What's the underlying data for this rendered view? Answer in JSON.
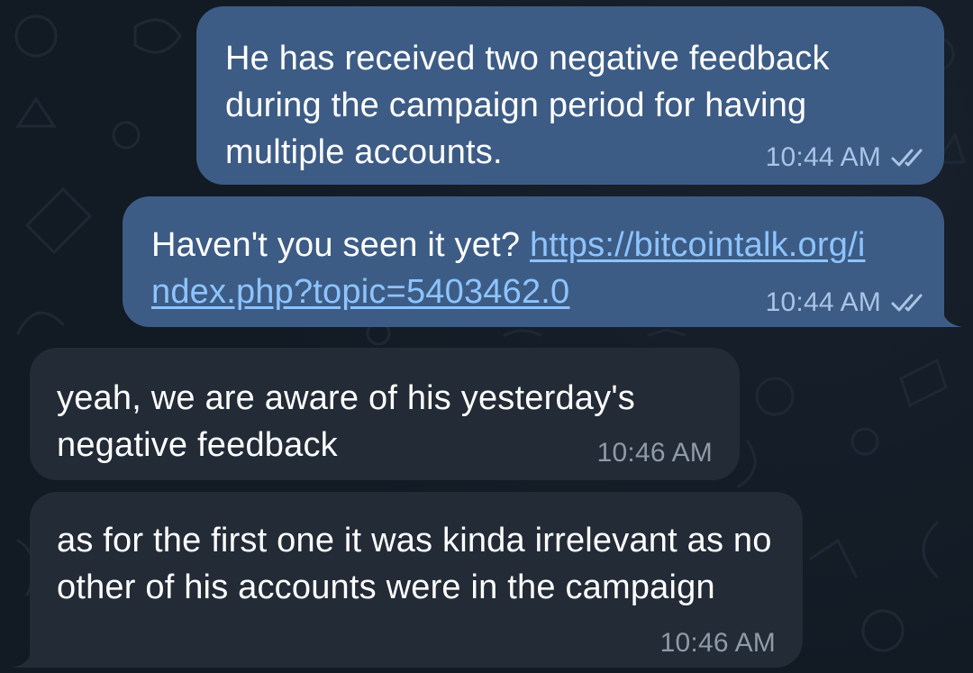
{
  "conversation": {
    "messages": [
      {
        "direction": "outgoing",
        "text": "He has received two negative feedback during the campaign period for having multiple accounts.",
        "time": "10:44 AM",
        "status_icon": "double-check-icon"
      },
      {
        "direction": "outgoing",
        "text": "Haven't you seen it yet? ",
        "link_text": "https://bitcointalk.org/index.php?topic=5403462.0",
        "time": "10:44 AM",
        "status_icon": "double-check-icon"
      },
      {
        "direction": "incoming",
        "text": "yeah, we are aware of his yesterday's negative feedback",
        "time": "10:46 AM"
      },
      {
        "direction": "incoming",
        "text": "as for the first one it was kinda irrelevant as no other of his accounts were in the campaign",
        "time": "10:46 AM"
      }
    ]
  },
  "colors": {
    "background": "#121a24",
    "outgoing_bubble": "#3d5c85",
    "incoming_bubble": "#222b36",
    "link": "#8dc4ff"
  }
}
